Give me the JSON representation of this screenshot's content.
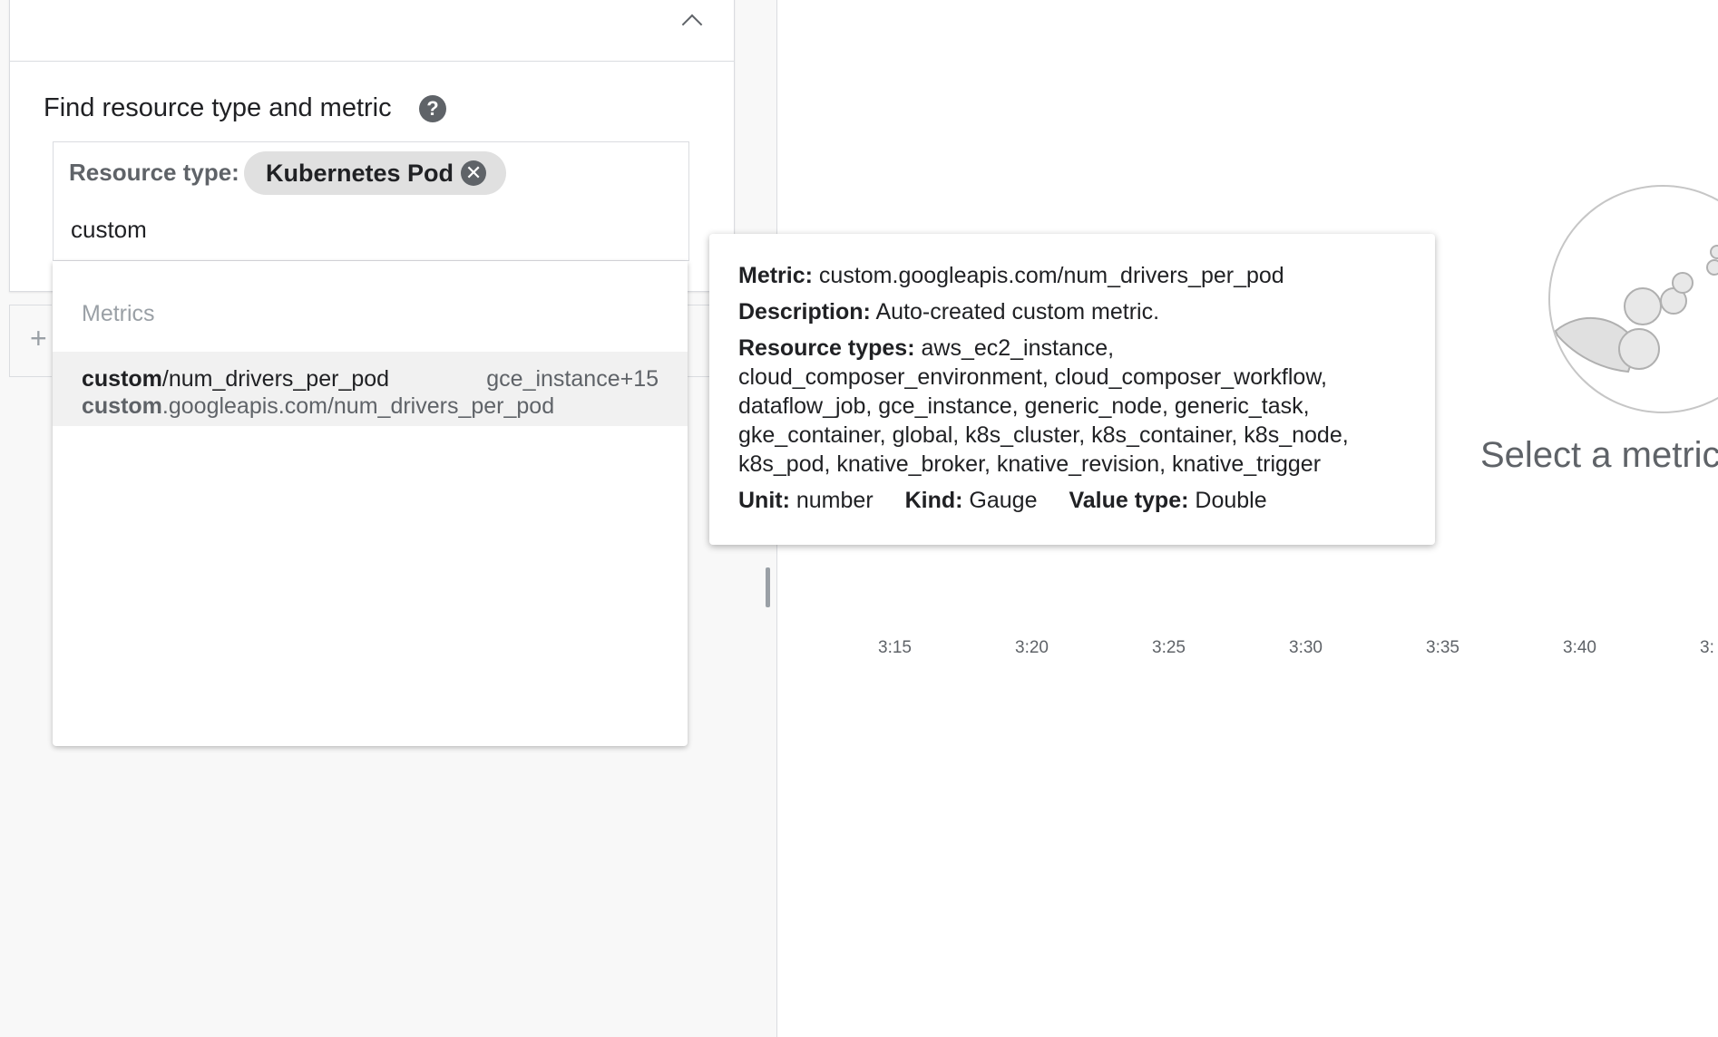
{
  "finder": {
    "title": "Find resource type and metric",
    "help_icon": "help-icon",
    "resource_type_label": "Resource type:",
    "chip_label": "Kubernetes Pod",
    "chip_close_icon": "✕",
    "query": "custom"
  },
  "dropdown": {
    "header": "Metrics",
    "item": {
      "name_bold": "custom",
      "name_rest": "/num_drivers_per_pod",
      "resources": "gce_instance+15",
      "full_bold": "custom",
      "full_rest": ".googleapis.com/num_drivers_per_pod"
    }
  },
  "add_button": "+",
  "tooltip": {
    "metric_label": "Metric:",
    "metric_value": "custom.googleapis.com/num_drivers_per_pod",
    "description_label": "Description:",
    "description_value": "Auto-created custom metric.",
    "resource_types_label": "Resource types:",
    "resource_types_line1": "aws_ec2_instance,",
    "resource_types_line2": "cloud_composer_environment, cloud_composer_workflow,",
    "resource_types_line3": "dataflow_job, gce_instance, generic_node, generic_task,",
    "resource_types_line4": "gke_container, global, k8s_cluster, k8s_container, k8s_node,",
    "resource_types_line5": "k8s_pod, knative_broker, knative_revision, knative_trigger",
    "unit_label": "Unit:",
    "unit_value": "number",
    "kind_label": "Kind:",
    "kind_value": "Gauge",
    "value_type_label": "Value type:",
    "value_type_value": "Double"
  },
  "chart": {
    "ticks": [
      "3:15",
      "3:20",
      "3:25",
      "3:30",
      "3:35",
      "3:40",
      "3:"
    ],
    "empty_message": "Select a metric"
  }
}
